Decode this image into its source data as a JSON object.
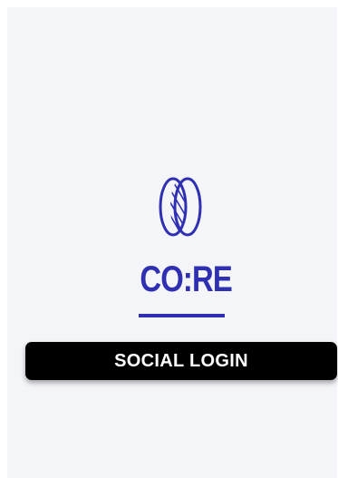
{
  "brand": {
    "logo_text": "CO:RE",
    "logo_icon": "overlapping-circles-logo-icon",
    "color": "#2f2fb2"
  },
  "login": {
    "button_label": "SOCIAL LOGIN"
  },
  "colors": {
    "background": "#f4f5f9",
    "button_bg": "#000000",
    "button_text": "#ffffff"
  }
}
